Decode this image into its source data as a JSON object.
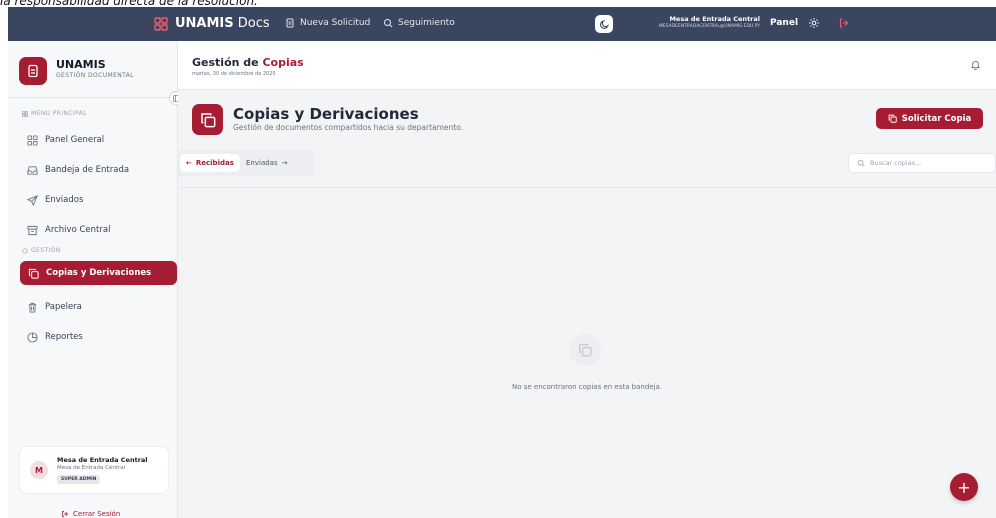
{
  "caption": "la responsabilidad directa de la resolución.",
  "nav": {
    "brand_bold": "UNAMIS",
    "brand_light": " Docs",
    "new_request": "Nueva Solicitud",
    "tracking": "Seguimiento",
    "user_name": "Mesa de Entrada Central",
    "user_email": "MESADEENTRADACENTRAL@UNAMIS.EDU.PY",
    "panel": "Panel"
  },
  "sidebar": {
    "logo_title": "UNAMIS",
    "logo_subtitle": "GESTIÓN DOCUMENTAL",
    "section_main": "MENU PRINCIPAL",
    "section_management": "GESTIÓN",
    "items": [
      {
        "label": "Panel General",
        "icon": "grid-icon"
      },
      {
        "label": "Bandeja de Entrada",
        "icon": "inbox-icon"
      },
      {
        "label": "Enviados",
        "icon": "send-icon"
      },
      {
        "label": "Archivo Central",
        "icon": "archive-icon"
      },
      {
        "label": "Copias y Derivaciones",
        "icon": "copy-icon"
      },
      {
        "label": "Papelera",
        "icon": "trash-icon"
      },
      {
        "label": "Reportes",
        "icon": "pie-chart-icon"
      }
    ],
    "user": {
      "initial": "M",
      "name": "Mesa de Entrada Central",
      "subtitle": "Mesa de Entrada Central",
      "badge": "SUPER ADMIN"
    },
    "logout": "Cerrar Sesión"
  },
  "header": {
    "title_prefix": "Gestión de ",
    "title_accent": "Copias",
    "date": "martes, 30 de diciembre de 2025"
  },
  "page": {
    "title": "Copias y Derivaciones",
    "subtitle": "Gestión de documentos compartidos hacia su departamento.",
    "primary_button": "Solicitar Copia",
    "tabs": {
      "received": "Recibidas",
      "sent": "Enviadas"
    },
    "search_placeholder": "Buscar copias...",
    "empty_message": "No se encontraron copias en esta bandeja.",
    "fab": "+"
  },
  "colors": {
    "brand": "#a61d33",
    "navbar": "#3a4660"
  }
}
